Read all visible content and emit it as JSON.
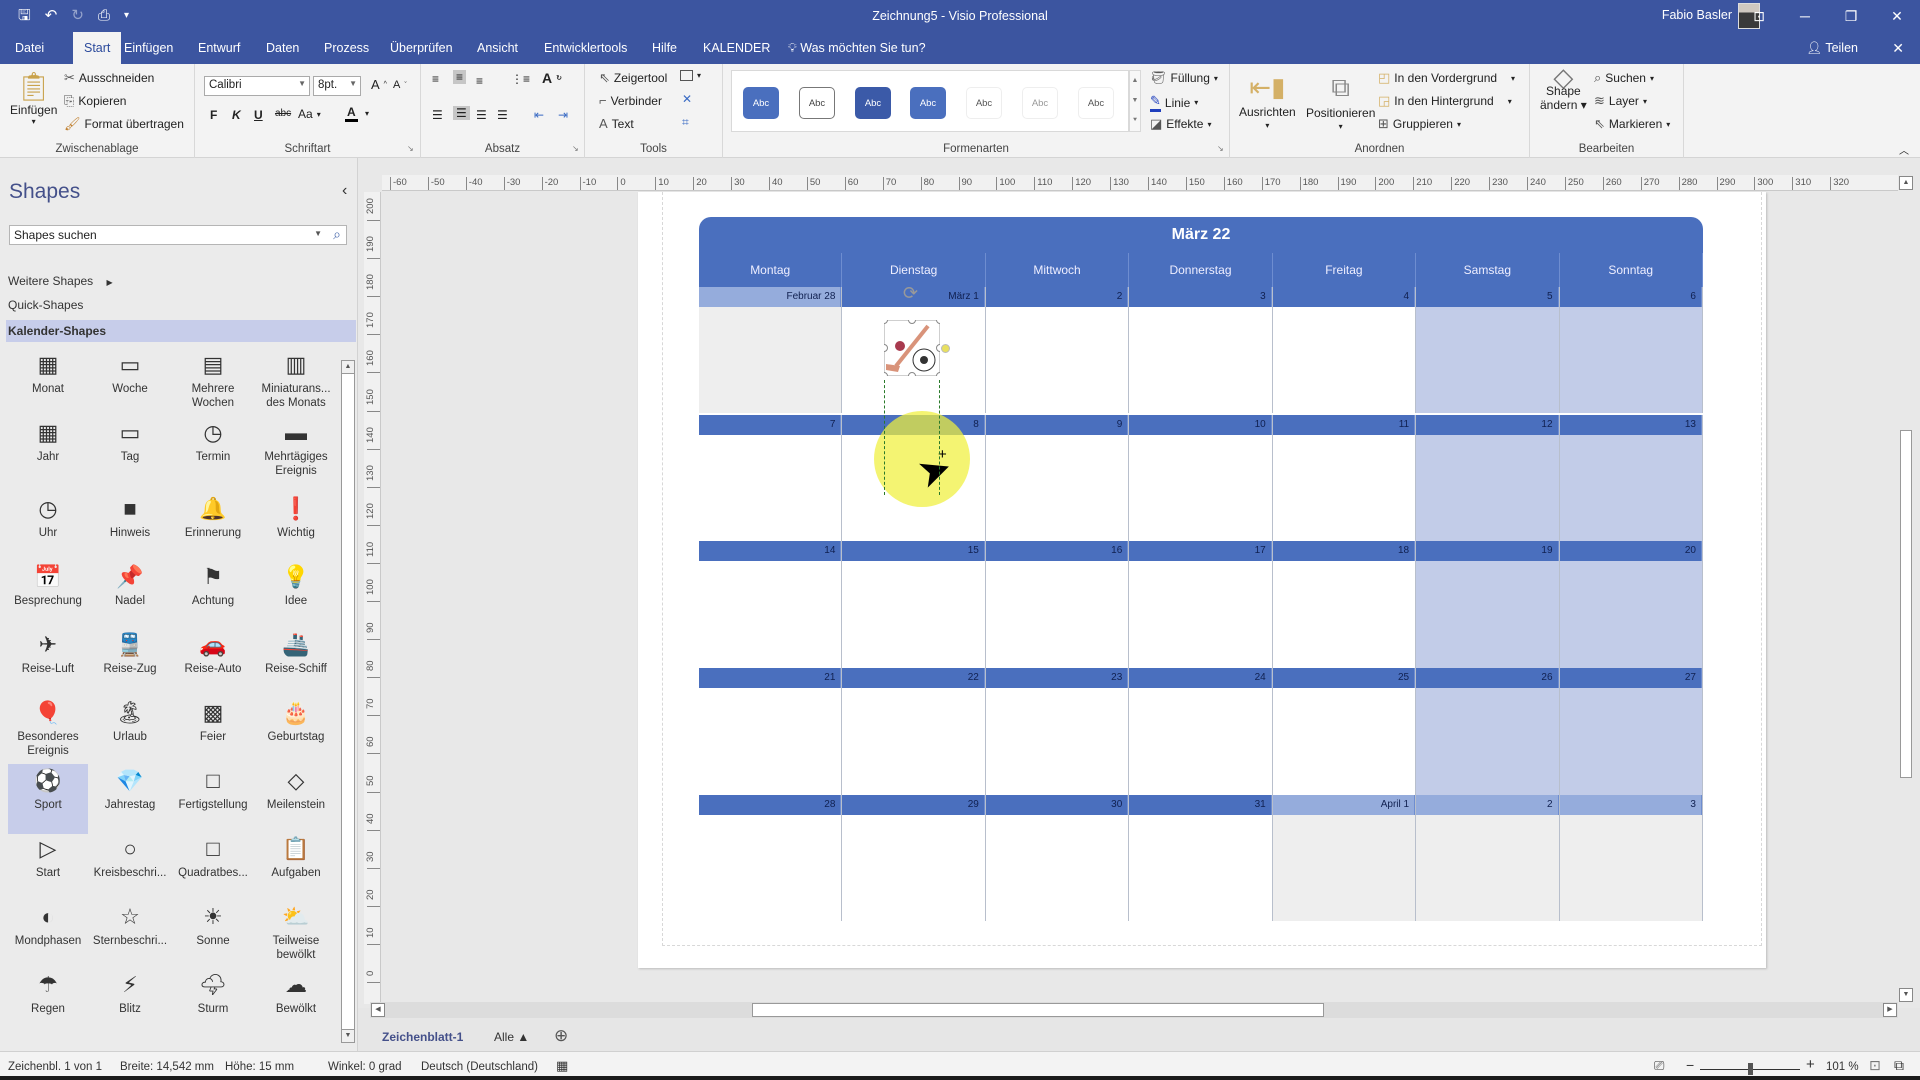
{
  "titlebar": {
    "title": "Zeichnung5 - Visio Professional",
    "user": "Fabio Basler",
    "qat": [
      "save-icon",
      "undo-icon",
      "redo-icon",
      "print-icon",
      "customize-icon"
    ]
  },
  "tabs": [
    "Datei",
    "Start",
    "Einfügen",
    "Entwurf",
    "Daten",
    "Prozess",
    "Überprüfen",
    "Ansicht",
    "Entwicklertools",
    "Hilfe",
    "KALENDER"
  ],
  "active_tab": "Start",
  "tellme": "Was möchten Sie tun?",
  "share": "Teilen",
  "ribbon": {
    "clipboard": {
      "paste": "Einfügen",
      "cut": "Ausschneiden",
      "copy": "Kopieren",
      "format_painter": "Format übertragen",
      "label": "Zwischenablage"
    },
    "font": {
      "family": "Calibri",
      "size": "8pt.",
      "bold": "F",
      "italic": "K",
      "underline": "U",
      "strike": "abc",
      "case": "Aa",
      "label": "Schriftart"
    },
    "paragraph": {
      "label": "Absatz"
    },
    "tools": {
      "pointer": "Zeigertool",
      "connector": "Verbinder",
      "text": "Text",
      "label": "Tools"
    },
    "styles": {
      "sample": "Abc",
      "label": "Formenarten",
      "fill": "Füllung",
      "line": "Linie",
      "effects": "Effekte"
    },
    "arrange": {
      "align": "Ausrichten",
      "position": "Positionieren",
      "front": "In den Vordergrund",
      "back": "In den Hintergrund",
      "group": "Gruppieren",
      "label": "Anordnen"
    },
    "edit": {
      "change_shape_1": "Shape",
      "change_shape_2": "ändern",
      "find": "Suchen",
      "layer": "Layer",
      "select": "Markieren",
      "label": "Bearbeiten"
    }
  },
  "panel": {
    "title": "Shapes",
    "search_placeholder": "Shapes suchen",
    "more_shapes": "Weitere Shapes",
    "quick_shapes": "Quick-Shapes",
    "stencil": "Kalender-Shapes",
    "shapes": [
      {
        "label": "Monat",
        "icon": "▦"
      },
      {
        "label": "Woche",
        "icon": "▭"
      },
      {
        "label": "Mehrere Wochen",
        "icon": "▤"
      },
      {
        "label": "Miniaturans... des Monats",
        "icon": "▥"
      },
      {
        "label": "Jahr",
        "icon": "▦"
      },
      {
        "label": "Tag",
        "icon": "▭"
      },
      {
        "label": "Termin",
        "icon": "◷"
      },
      {
        "label": "Mehrtägiges Ereignis",
        "icon": "▬"
      },
      {
        "label": "Uhr",
        "icon": "◷"
      },
      {
        "label": "Hinweis",
        "icon": "■"
      },
      {
        "label": "Erinnerung",
        "icon": "🔔"
      },
      {
        "label": "Wichtig",
        "icon": "❗"
      },
      {
        "label": "Besprechung",
        "icon": "📅"
      },
      {
        "label": "Nadel",
        "icon": "📌"
      },
      {
        "label": "Achtung",
        "icon": "⚑"
      },
      {
        "label": "Idee",
        "icon": "💡"
      },
      {
        "label": "Reise-Luft",
        "icon": "✈"
      },
      {
        "label": "Reise-Zug",
        "icon": "🚆"
      },
      {
        "label": "Reise-Auto",
        "icon": "🚗"
      },
      {
        "label": "Reise-Schiff",
        "icon": "🚢"
      },
      {
        "label": "Besonderes Ereignis",
        "icon": "🎈"
      },
      {
        "label": "Urlaub",
        "icon": "🏝"
      },
      {
        "label": "Feier",
        "icon": "▩"
      },
      {
        "label": "Geburtstag",
        "icon": "🎂"
      },
      {
        "label": "Sport",
        "icon": "⚽"
      },
      {
        "label": "Jahrestag",
        "icon": "💎"
      },
      {
        "label": "Fertigstellung",
        "icon": "□"
      },
      {
        "label": "Meilenstein",
        "icon": "◇"
      },
      {
        "label": "Start",
        "icon": "▷"
      },
      {
        "label": "Kreisbeschri...",
        "icon": "○"
      },
      {
        "label": "Quadratbes...",
        "icon": "□"
      },
      {
        "label": "Aufgaben",
        "icon": "📋"
      },
      {
        "label": "Mondphasen",
        "icon": "◐"
      },
      {
        "label": "Sternbeschri...",
        "icon": "☆"
      },
      {
        "label": "Sonne",
        "icon": "☀"
      },
      {
        "label": "Teilweise bewölkt",
        "icon": "⛅"
      },
      {
        "label": "Regen",
        "icon": "☂"
      },
      {
        "label": "Blitz",
        "icon": "⚡"
      },
      {
        "label": "Sturm",
        "icon": "🌩"
      },
      {
        "label": "Bewölkt",
        "icon": "☁"
      }
    ],
    "selected_shape": "Sport"
  },
  "ruler": {
    "h": [
      "-60",
      "-50",
      "-40",
      "-30",
      "-20",
      "-10",
      "0",
      "10",
      "20",
      "30",
      "40",
      "50",
      "60",
      "70",
      "80",
      "90",
      "100",
      "110",
      "120",
      "130",
      "140",
      "150",
      "160",
      "170",
      "180",
      "190",
      "200",
      "210",
      "220",
      "230",
      "240",
      "250",
      "260",
      "270",
      "280",
      "290",
      "300",
      "310",
      "320"
    ],
    "v": [
      "200",
      "190",
      "180",
      "170",
      "160",
      "150",
      "140",
      "130",
      "120",
      "110",
      "100",
      "90",
      "80",
      "70",
      "60",
      "50",
      "40",
      "30",
      "20",
      "10",
      "0"
    ]
  },
  "calendar": {
    "title": "März 22",
    "days": [
      "Montag",
      "Dienstag",
      "Mittwoch",
      "Donnerstag",
      "Freitag",
      "Samstag",
      "Sonntag"
    ],
    "weeks": [
      [
        "Februar 28",
        "März 1",
        "2",
        "3",
        "4",
        "5",
        "6"
      ],
      [
        "7",
        "8",
        "9",
        "10",
        "11",
        "12",
        "13"
      ],
      [
        "14",
        "15",
        "16",
        "17",
        "18",
        "19",
        "20"
      ],
      [
        "21",
        "22",
        "23",
        "24",
        "25",
        "26",
        "27"
      ],
      [
        "28",
        "29",
        "30",
        "31",
        "April 1",
        "2",
        "3"
      ]
    ]
  },
  "sheets": {
    "active": "Zeichenblatt-1",
    "all": "Alle ▲",
    "add": "⊕"
  },
  "status": {
    "page": "Zeichenbl. 1 von 1",
    "width": "Breite: 14,542 mm",
    "height": "Höhe: 15 mm",
    "angle": "Winkel: 0 grad",
    "language": "Deutsch (Deutschland)",
    "zoom": "101 %",
    "zoom_percent": 101
  }
}
